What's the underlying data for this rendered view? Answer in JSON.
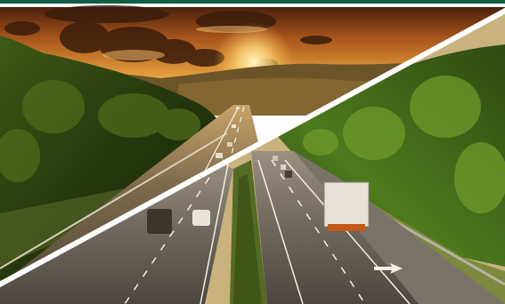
{
  "scene": {
    "subject": "highway-at-sunset",
    "split": "diagonal",
    "colors": {
      "sky_top": "#5a2a12",
      "sky_mid": "#c8752a",
      "sun": "#ffe9a8",
      "hills": "#5b4a25",
      "trees_dark": "#1f3a12",
      "trees_light": "#6f8f2a",
      "asphalt": "#6b5a43",
      "asphalt_light": "#8b7a5f",
      "lane_marks": "#f3efe2",
      "divider": "#ffffff",
      "frame_top": "#0f5e45"
    }
  }
}
